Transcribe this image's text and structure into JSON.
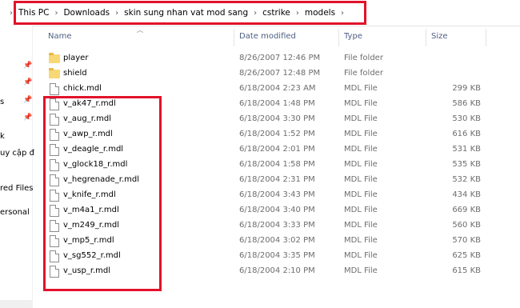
{
  "breadcrumb": [
    "This PC",
    "Downloads",
    "skin sung nhan vat mod sang",
    "cstrike",
    "models"
  ],
  "nav": {
    "labels": [
      "s",
      "k",
      "uy cập đ",
      "red Files",
      "ersonal"
    ]
  },
  "columns": {
    "name": "Name",
    "date": "Date modified",
    "type": "Type",
    "size": "Size"
  },
  "files": [
    {
      "name": "player",
      "date": "8/26/2007 12:46 PM",
      "type": "File folder",
      "size": "",
      "kind": "folder"
    },
    {
      "name": "shield",
      "date": "8/26/2007 12:48 PM",
      "type": "File folder",
      "size": "",
      "kind": "folder"
    },
    {
      "name": "chick.mdl",
      "date": "6/18/2004 2:23 AM",
      "type": "MDL File",
      "size": "299 KB",
      "kind": "file"
    },
    {
      "name": "v_ak47_r.mdl",
      "date": "6/18/2004 1:48 PM",
      "type": "MDL File",
      "size": "586 KB",
      "kind": "file"
    },
    {
      "name": "v_aug_r.mdl",
      "date": "6/18/2004 3:30 PM",
      "type": "MDL File",
      "size": "530 KB",
      "kind": "file"
    },
    {
      "name": "v_awp_r.mdl",
      "date": "6/18/2004 1:52 PM",
      "type": "MDL File",
      "size": "616 KB",
      "kind": "file"
    },
    {
      "name": "v_deagle_r.mdl",
      "date": "6/18/2004 2:01 PM",
      "type": "MDL File",
      "size": "531 KB",
      "kind": "file"
    },
    {
      "name": "v_glock18_r.mdl",
      "date": "6/18/2004 1:58 PM",
      "type": "MDL File",
      "size": "535 KB",
      "kind": "file"
    },
    {
      "name": "v_hegrenade_r.mdl",
      "date": "6/18/2004 2:31 PM",
      "type": "MDL File",
      "size": "532 KB",
      "kind": "file"
    },
    {
      "name": "v_knife_r.mdl",
      "date": "6/18/2004 3:43 PM",
      "type": "MDL File",
      "size": "434 KB",
      "kind": "file"
    },
    {
      "name": "v_m4a1_r.mdl",
      "date": "6/18/2004 3:40 PM",
      "type": "MDL File",
      "size": "669 KB",
      "kind": "file"
    },
    {
      "name": "v_m249_r.mdl",
      "date": "6/18/2004 3:33 PM",
      "type": "MDL File",
      "size": "560 KB",
      "kind": "file"
    },
    {
      "name": "v_mp5_r.mdl",
      "date": "6/18/2004 3:02 PM",
      "type": "MDL File",
      "size": "570 KB",
      "kind": "file"
    },
    {
      "name": "v_sg552_r.mdl",
      "date": "6/18/2004 3:35 PM",
      "type": "MDL File",
      "size": "625 KB",
      "kind": "file"
    },
    {
      "name": "v_usp_r.mdl",
      "date": "6/18/2004 2:10 PM",
      "type": "MDL File",
      "size": "615 KB",
      "kind": "file"
    }
  ],
  "colors": {
    "highlight": "#e2122a",
    "header_text": "#4d6082",
    "folder": "#f8d775"
  }
}
